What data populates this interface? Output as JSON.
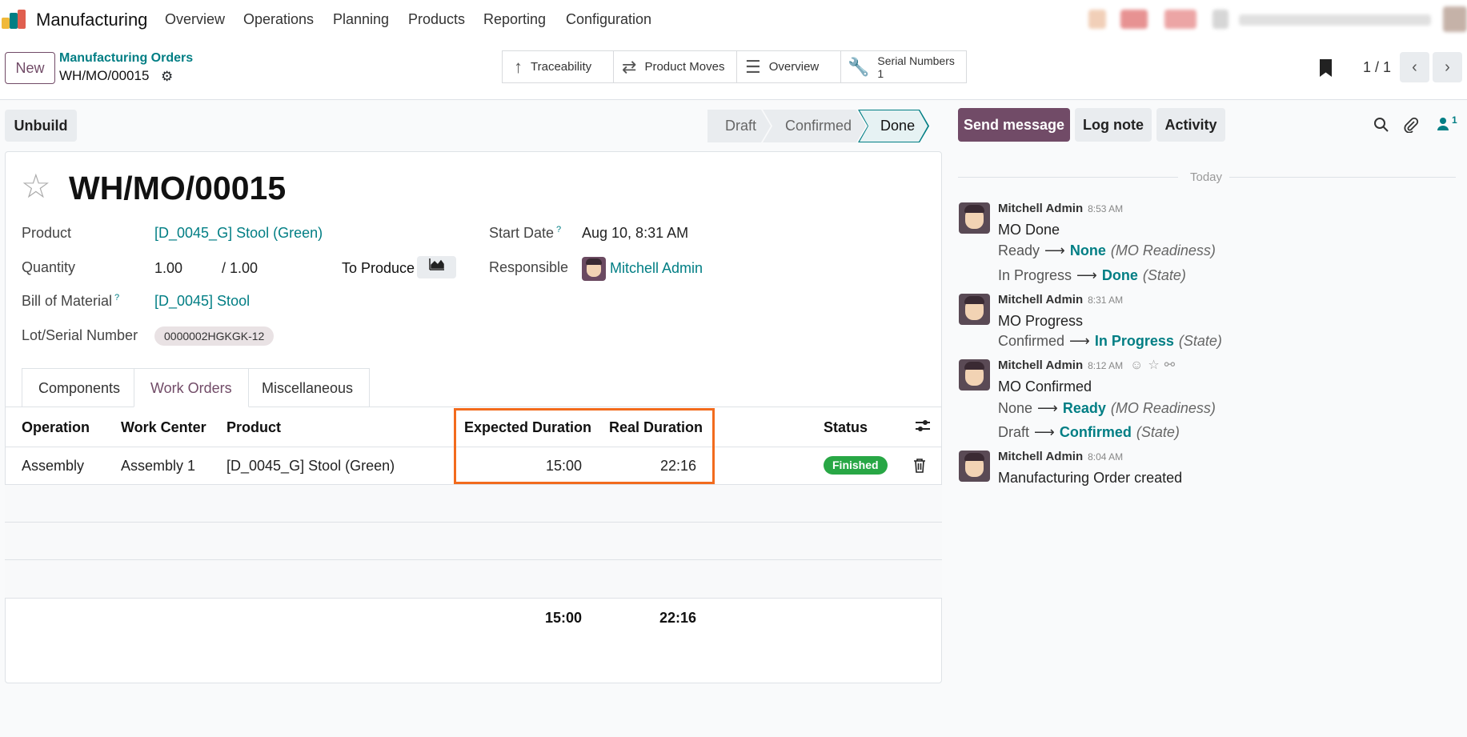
{
  "app": {
    "name": "Manufacturing",
    "menu": [
      "Overview",
      "Operations",
      "Planning",
      "Products",
      "Reporting",
      "Configuration"
    ]
  },
  "colors": {
    "brand": "#714b67",
    "accent": "#017e84",
    "success": "#28a745",
    "highlight": "#f26b1d"
  },
  "control": {
    "new_label": "New",
    "breadcrumb_parent": "Manufacturing Orders",
    "breadcrumb_current": "WH/MO/00015",
    "smart_buttons": {
      "traceability": "Traceability",
      "product_moves": "Product Moves",
      "overview": "Overview",
      "serial_numbers": "Serial Numbers",
      "serial_count": "1"
    },
    "pager": "1 / 1"
  },
  "actions": {
    "unbuild_label": "Unbuild",
    "stages": [
      "Draft",
      "Confirmed",
      "Done"
    ],
    "current_stage": "Done"
  },
  "record": {
    "title": "WH/MO/00015",
    "product_label": "Product",
    "product_value": "[D_0045_G] Stool (Green)",
    "quantity_label": "Quantity",
    "quantity_value": "1.00",
    "quantity_total": "/ 1.00",
    "to_produce_label": "To Produce",
    "bom_label": "Bill of Material",
    "bom_value": "[D_0045] Stool",
    "lot_label": "Lot/Serial Number",
    "lot_value": "0000002HGKGK-12",
    "start_date_label": "Start Date",
    "start_date_value": "Aug 10, 8:31 AM",
    "responsible_label": "Responsible",
    "responsible_value": "Mitchell Admin",
    "help_mark": "?"
  },
  "tabs": [
    "Components",
    "Work Orders",
    "Miscellaneous"
  ],
  "work_orders": {
    "headers": {
      "operation": "Operation",
      "work_center": "Work Center",
      "product": "Product",
      "expected": "Expected Duration",
      "real": "Real Duration",
      "status": "Status"
    },
    "rows": [
      {
        "operation": "Assembly",
        "work_center": "Assembly 1",
        "product": "[D_0045_G] Stool (Green)",
        "expected": "15:00",
        "real": "22:16",
        "status": "Finished"
      }
    ],
    "totals": {
      "expected": "15:00",
      "real": "22:16"
    }
  },
  "chatter": {
    "send_message": "Send message",
    "log_note": "Log note",
    "activity": "Activity",
    "followers_count": "1",
    "today": "Today",
    "messages": [
      {
        "author": "Mitchell Admin",
        "time": "8:53 AM",
        "body": "MO Done",
        "changes": [
          {
            "old": "Ready",
            "new": "None",
            "field": "(MO Readiness)"
          },
          {
            "old": "In Progress",
            "new": "Done",
            "field": "(State)"
          }
        ]
      },
      {
        "author": "Mitchell Admin",
        "time": "8:31 AM",
        "body": "MO Progress",
        "changes": [
          {
            "old": "Confirmed",
            "new": "In Progress",
            "field": "(State)"
          }
        ]
      },
      {
        "author": "Mitchell Admin",
        "time": "8:12 AM",
        "body": "MO Confirmed",
        "changes": [
          {
            "old": "None",
            "new": "Ready",
            "field": "(MO Readiness)"
          },
          {
            "old": "Draft",
            "new": "Confirmed",
            "field": "(State)"
          }
        ]
      },
      {
        "author": "Mitchell Admin",
        "time": "8:04 AM",
        "body": "Manufacturing Order created",
        "changes": []
      }
    ]
  }
}
